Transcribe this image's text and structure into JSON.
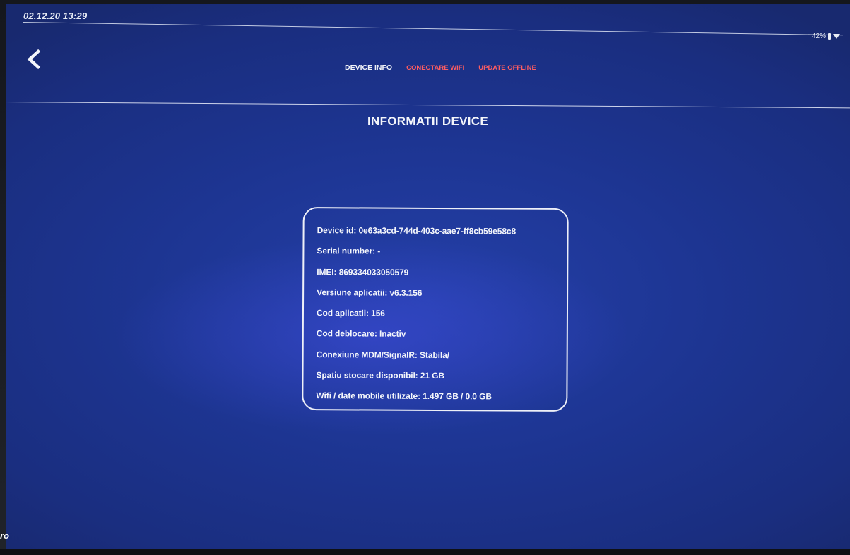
{
  "status_bar": {
    "datetime": "02.12.20 13:29",
    "battery": "42%",
    "icons": [
      "battery-icon",
      "wifi-icon"
    ]
  },
  "header": {
    "back_icon": "chevron-left-icon",
    "tabs": [
      {
        "label": "DEVICE INFO",
        "active": true
      },
      {
        "label": "CONECTARE WIFI",
        "active": false
      },
      {
        "label": "UPDATE OFFLINE",
        "active": false
      }
    ]
  },
  "page": {
    "title": "INFORMATII DEVICE"
  },
  "device_info": {
    "rows": [
      "Device id: 0e63a3cd-744d-403c-aae7-ff8cb59e58c8",
      "Serial number: -",
      "IMEI: 869334033050579",
      "Versiune aplicatii: v6.3.156",
      "Cod aplicatii: 156",
      "Cod deblocare: Inactiv",
      "Conexiune MDM/SignalR: Stabila/",
      "Spatiu stocare disponibil: 21 GB",
      "Wifi / date mobile utilizate: 1.497 GB / 0.0 GB"
    ]
  },
  "brand": {
    "fragment": "ro"
  },
  "colors": {
    "background": "#1d3592",
    "active_tab": "#f1f3f8",
    "inactive_tab": "#ff5d61",
    "text": "#f4f6fb"
  }
}
